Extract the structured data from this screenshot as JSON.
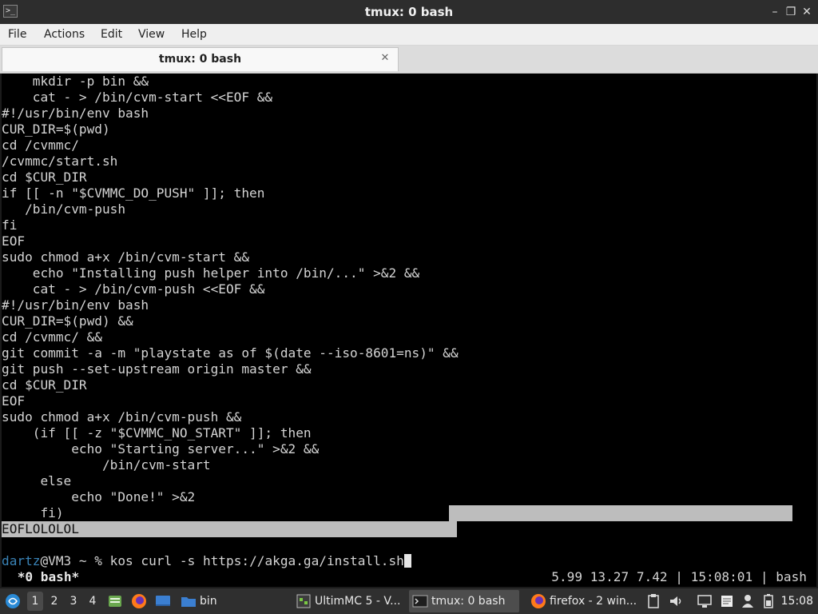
{
  "window": {
    "title": "tmux: 0 bash",
    "app_icon_glyph": ">_",
    "minimize_glyph": "–",
    "maximize_glyph": "❐",
    "close_glyph": "✕"
  },
  "menu": {
    "items": [
      "File",
      "Actions",
      "Edit",
      "View",
      "Help"
    ]
  },
  "tab": {
    "label": "tmux: 0 bash",
    "close_glyph": "✕"
  },
  "terminal": {
    "lines": [
      "    mkdir -p bin &&",
      "    cat - > /bin/cvm-start <<EOF &&",
      "#!/usr/bin/env bash",
      "CUR_DIR=$(pwd)",
      "cd /cvmmc/",
      "/cvmmc/start.sh",
      "cd $CUR_DIR",
      "if [[ -n \"$CVMMC_DO_PUSH\" ]]; then",
      "   /bin/cvm-push",
      "fi",
      "EOF",
      "sudo chmod a+x /bin/cvm-start &&",
      "    echo \"Installing push helper into /bin/...\" >&2 &&",
      "    cat - > /bin/cvm-push <<EOF &&",
      "#!/usr/bin/env bash",
      "CUR_DIR=$(pwd) &&",
      "cd /cvmmc/ &&",
      "git commit -a -m \"playstate as of $(date --iso-8601=ns)\" &&",
      "git push --set-upstream origin master &&",
      "cd $CUR_DIR",
      "EOF",
      "sudo chmod a+x /bin/cvm-push &&",
      "    (if [[ -z \"$CVMMC_NO_START\" ]]; then",
      "         echo \"Starting server...\" >&2 &&",
      "             /bin/cvm-start",
      "     else",
      "         echo \"Done!\" >&2",
      "     fi)"
    ],
    "eof_marker": "EOFLOLOLOL",
    "prompt": {
      "user": "dartz",
      "host_path": "@VM3 ~ % ",
      "command": "kos curl -s https://akga.ga/install.sh"
    },
    "status": {
      "left": " *0 bash*",
      "right": "5.99 13.27 7.42 | 15:08:01 | bash"
    }
  },
  "taskbar": {
    "workspaces": [
      "1",
      "2",
      "3",
      "4"
    ],
    "active_workspace": "1",
    "folder_label": "bin",
    "tasks": [
      {
        "label": "UltimMC 5 - V...",
        "icon": "ultimmc-icon"
      },
      {
        "label": "tmux: 0 bash",
        "icon": "terminal-icon"
      },
      {
        "label": "firefox - 2 win...",
        "icon": "firefox-icon"
      }
    ],
    "clock": "15:08",
    "colors": {
      "accent": "#3a84b8",
      "firefox": "#ff7a1a"
    }
  }
}
